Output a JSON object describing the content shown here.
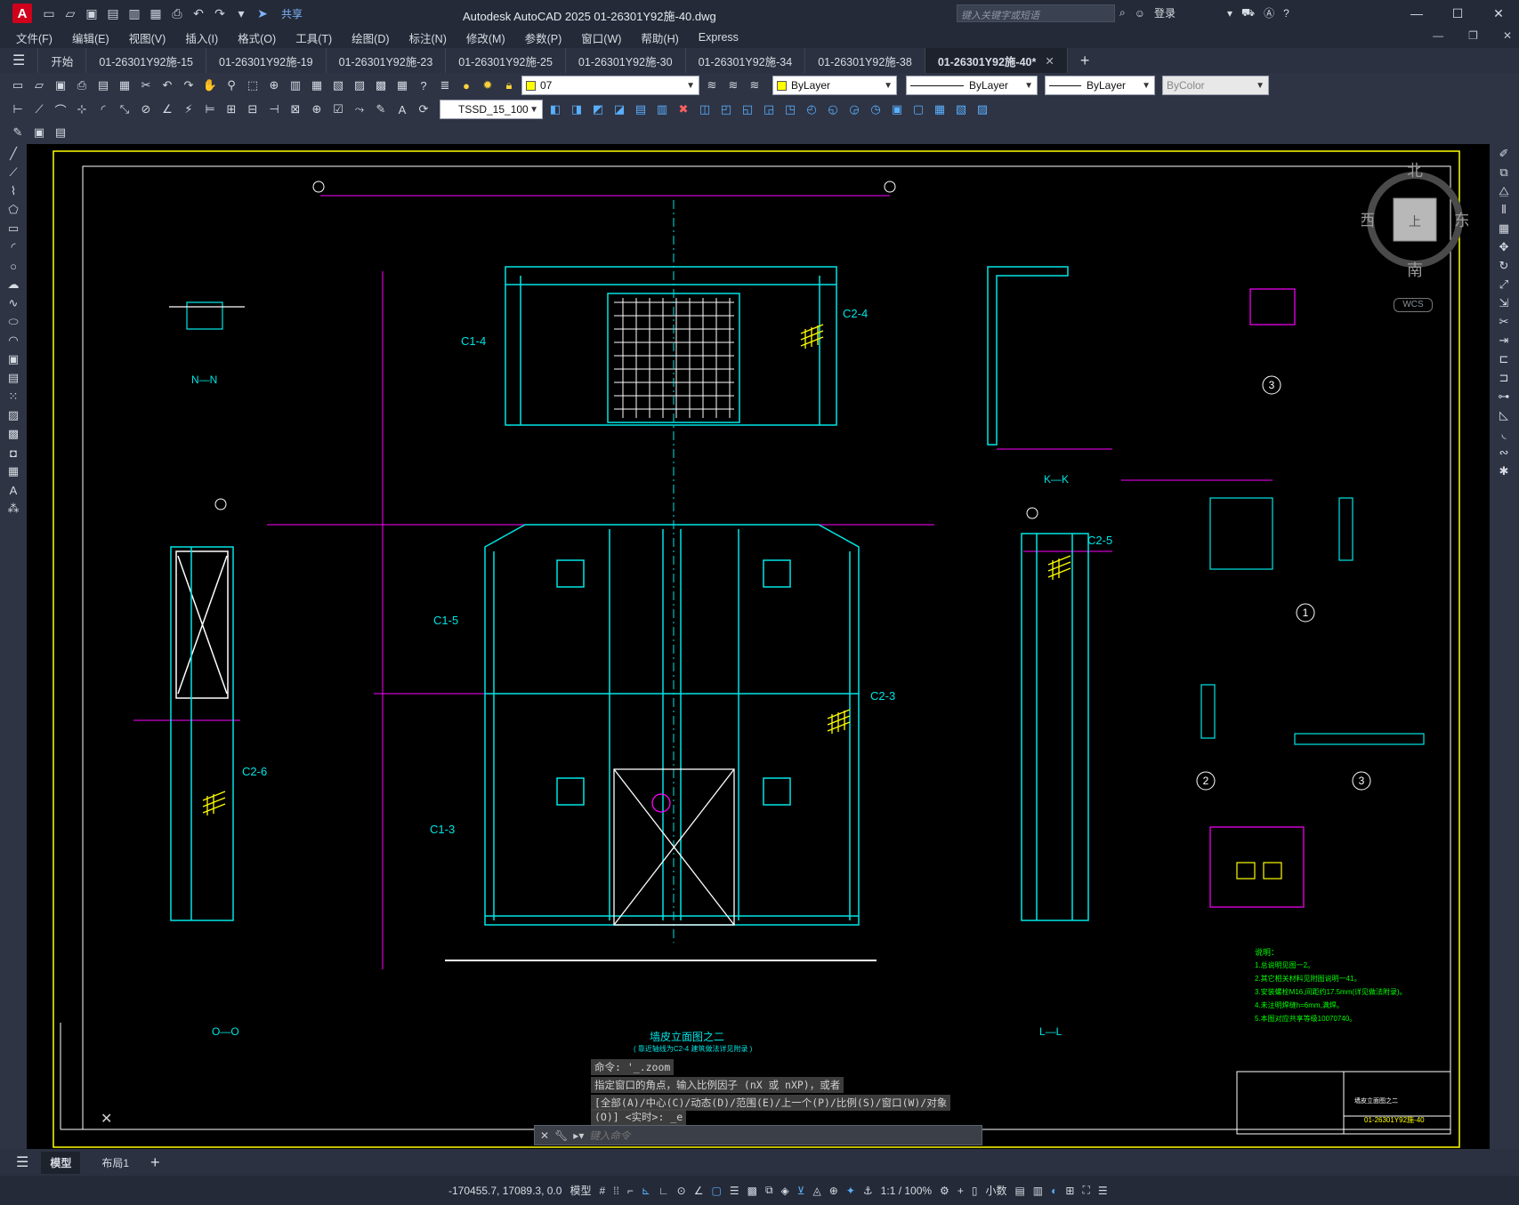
{
  "titlebar": {
    "app_letter": "A",
    "share_label": "共享",
    "window_title": "Autodesk AutoCAD 2025    01-26301Y92施-40.dwg",
    "search_placeholder": "键入关键字或短语",
    "login_label": "登录"
  },
  "menu": [
    "文件(F)",
    "编辑(E)",
    "视图(V)",
    "插入(I)",
    "格式(O)",
    "工具(T)",
    "绘图(D)",
    "标注(N)",
    "修改(M)",
    "参数(P)",
    "窗口(W)",
    "帮助(H)",
    "Express"
  ],
  "tabs": [
    {
      "label": "开始"
    },
    {
      "label": "01-26301Y92施-15"
    },
    {
      "label": "01-26301Y92施-19"
    },
    {
      "label": "01-26301Y92施-23"
    },
    {
      "label": "01-26301Y92施-25"
    },
    {
      "label": "01-26301Y92施-30"
    },
    {
      "label": "01-26301Y92施-34"
    },
    {
      "label": "01-26301Y92施-38"
    },
    {
      "label": "01-26301Y92施-40*",
      "active": true
    }
  ],
  "toolbar": {
    "layer_value": "07",
    "color_value": "ByLayer",
    "linetype_value": "ByLayer",
    "lineweight_value": "ByLayer",
    "plotstyle_value": "ByColor",
    "dimstyle_value": "TSSD_15_100",
    "layer_color": "#ffff00"
  },
  "viewcube": {
    "north": "北",
    "south": "南",
    "east": "东",
    "west": "西",
    "top": "上",
    "wcs": "WCS"
  },
  "drawing": {
    "title": "墙皮立面图之二",
    "subtitle": "( 靠近轴线为C2-4  建筑做法详见附录 )",
    "section_labels": [
      "N—N",
      "K—K",
      "O—O",
      "L—L"
    ],
    "member_labels": [
      "C1-4",
      "C2-4",
      "C1-5",
      "C2-3",
      "C1-3",
      "C2-5",
      "C2-6",
      "C1-3"
    ],
    "detail_numbers": [
      "3",
      "1",
      "2",
      "3"
    ],
    "notes_title": "说明：",
    "notes": [
      "1.总说明见图一2。",
      "2.其它相关材料见附图说明一41。",
      "3.安装螺栓M16,间距约17.5mm(详见做法附录)。",
      "4.未注明焊缝h=6mm,满焊。",
      "5.本图对应共享等级10070740。"
    ],
    "titleblock_number": "01-26301Y92施-40",
    "titleblock_name": "墙皮立面图之二"
  },
  "command": {
    "history": [
      "命令: '_.zoom",
      "指定窗口的角点，输入比例因子 (nX 或 nXP)，或者",
      "[全部(A)/中心(C)/动态(D)/范围(E)/上一个(P)/比例(S)/窗口(W)/对象",
      "(O)] <实时>: _e"
    ],
    "placeholder": "键入命令"
  },
  "layout_tabs": [
    "模型",
    "布局1"
  ],
  "status": {
    "coords": "-170455.7, 17089.3, 0.0",
    "mode": "模型",
    "scale": "1:1 / 100%",
    "units": "小数"
  }
}
